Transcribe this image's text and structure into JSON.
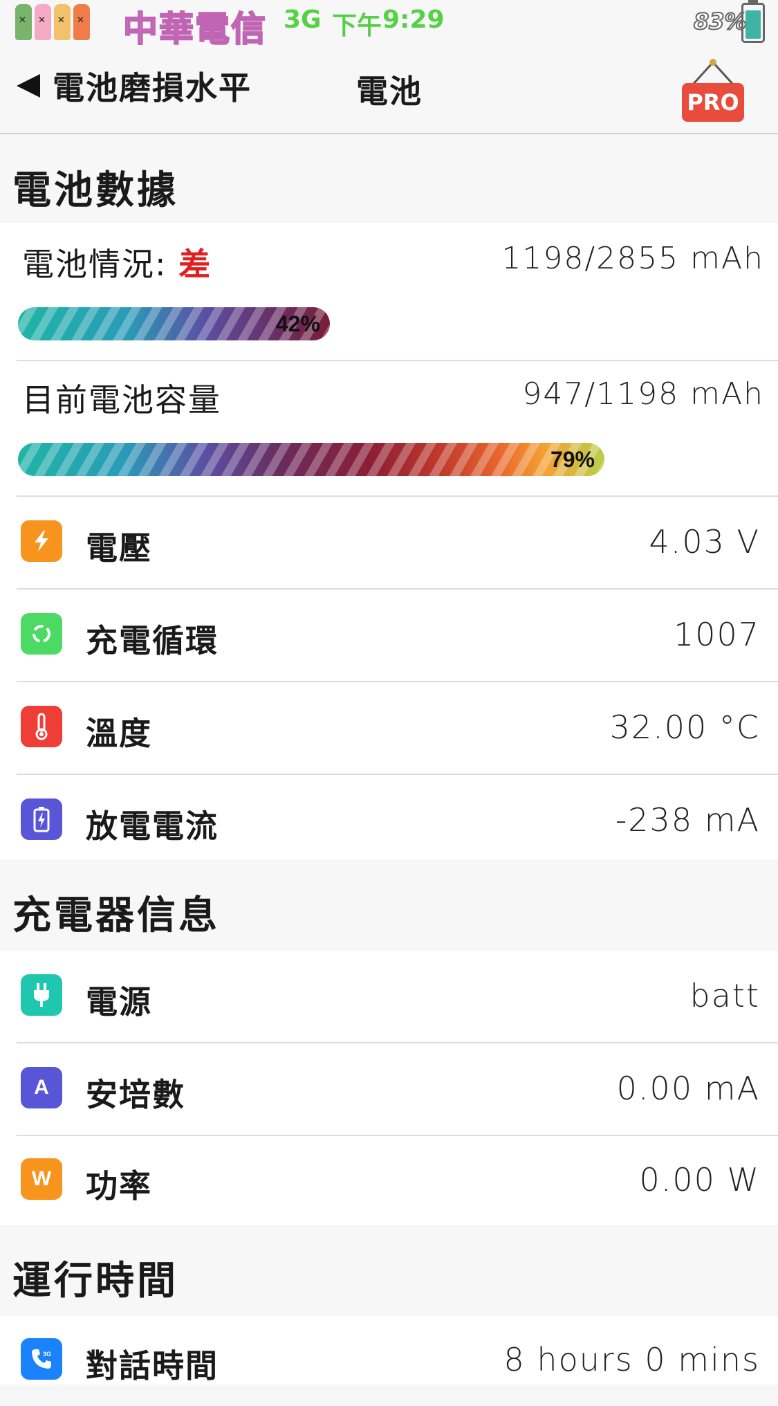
{
  "status_bar": {
    "carrier": "中華電信",
    "network": "3G",
    "time_label": "下午",
    "time": "9:29",
    "battery_pct": "83%"
  },
  "nav": {
    "back_label": "電池磨損水平",
    "title": "電池",
    "pro_label": "PRO"
  },
  "battery_section": {
    "title": "電池數據",
    "health": {
      "label": "電池情況:",
      "status": "差",
      "value": "1198/2855 mAh",
      "percent_label": "42%",
      "percent": 42
    },
    "capacity": {
      "label": "目前電池容量",
      "value": "947/1198 mAh",
      "percent_label": "79%",
      "percent": 79
    },
    "items": [
      {
        "label": "電壓",
        "value": "4.03 V",
        "icon": "bolt-icon",
        "color": "#f7941d"
      },
      {
        "label": "充電循環",
        "value": "1007",
        "icon": "cycle-icon",
        "color": "#4cd964"
      },
      {
        "label": "溫度",
        "value": "32.00 °C",
        "icon": "thermometer-icon",
        "color": "#ef3e36"
      },
      {
        "label": "放電電流",
        "value": "-238 mA",
        "icon": "battery-icon",
        "color": "#5856d6"
      }
    ]
  },
  "charger_section": {
    "title": "充電器信息",
    "items": [
      {
        "label": "電源",
        "value": "batt",
        "icon": "plug-icon",
        "color": "#1fc7b0"
      },
      {
        "label": "安培數",
        "value": "0.00 mA",
        "icon": "ampere-icon",
        "glyph": "A",
        "color": "#5856d6"
      },
      {
        "label": "功率",
        "value": "0.00 W",
        "icon": "watt-icon",
        "glyph": "W",
        "color": "#f7941d"
      }
    ]
  },
  "runtime_section": {
    "title": "運行時間",
    "items": [
      {
        "label": "對話時間",
        "value": "8 hours 0 mins",
        "icon": "phone-3g-icon",
        "color": "#1a82fb"
      }
    ]
  }
}
